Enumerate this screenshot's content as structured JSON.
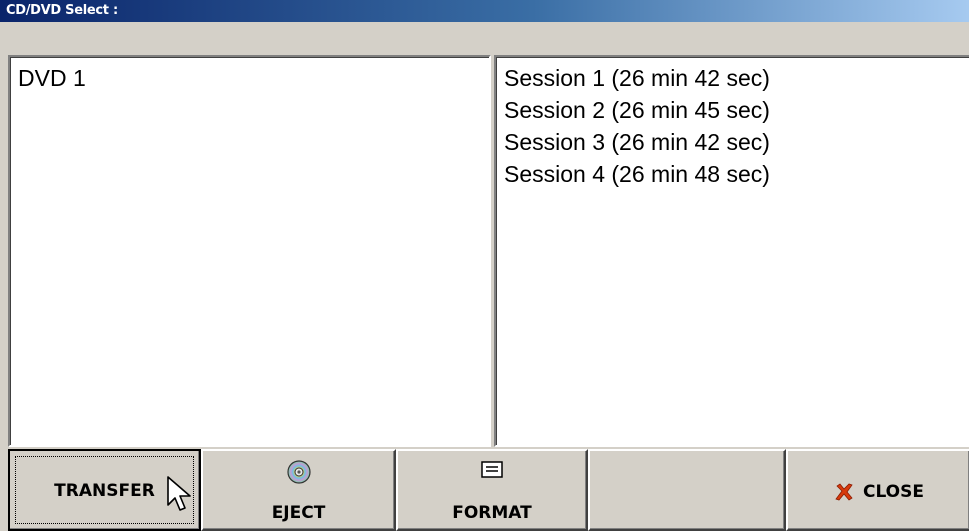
{
  "window": {
    "title": "CD/DVD Select :"
  },
  "discs": {
    "items": [
      "DVD 1"
    ]
  },
  "sessions": {
    "items": [
      "Session 1 (26 min 42 sec)",
      "Session 2 (26 min 45 sec)",
      "Session 3 (26 min 42 sec)",
      "Session 4 (26 min 48 sec)"
    ]
  },
  "buttons": {
    "transfer": "TRANSFER",
    "eject": "EJECT",
    "format": "FORMAT",
    "close": "CLOSE"
  },
  "icons": {
    "eject": "disc-icon",
    "format": "drive-icon",
    "close": "close-x-icon",
    "cursor": "mouse-pointer-icon"
  },
  "colors": {
    "titlebar_start": "#0a246a",
    "titlebar_end": "#a6caf0",
    "close_x": "#d83a0c",
    "face": "#d4d0c8"
  }
}
